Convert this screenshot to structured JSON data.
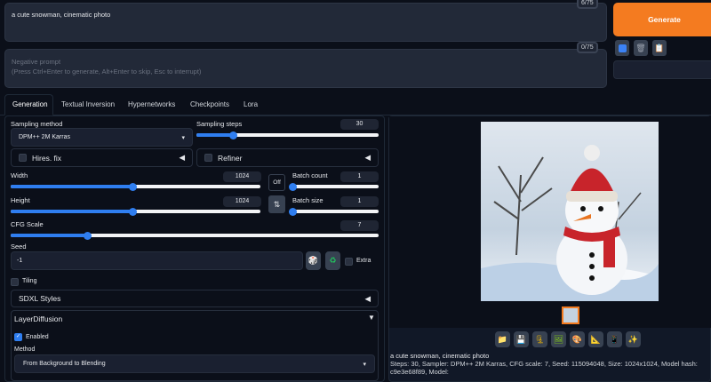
{
  "prompt": {
    "value": "a cute snowman, cinematic photo",
    "counter": "6/75"
  },
  "negative_prompt": {
    "placeholder_line1": "Negative prompt",
    "placeholder_line2": "(Press Ctrl+Enter to generate, Alt+Enter to skip, Esc to interrupt)",
    "counter": "0/75"
  },
  "generate_label": "Generate",
  "tabs": [
    "Generation",
    "Textual Inversion",
    "Hypernetworks",
    "Checkpoints",
    "Lora"
  ],
  "sampling_method": {
    "label": "Sampling method",
    "value": "DPM++ 2M Karras"
  },
  "sampling_steps": {
    "label": "Sampling steps",
    "value": "30",
    "fraction": 0.2
  },
  "hires_fix": "Hires. fix",
  "refiner": "Refiner",
  "width": {
    "label": "Width",
    "value": "1024",
    "fraction": 0.49
  },
  "height": {
    "label": "Height",
    "value": "1024",
    "fraction": 0.49
  },
  "batch_count": {
    "label": "Batch count",
    "value": "1",
    "fraction": 0.0
  },
  "batch_size": {
    "label": "Batch size",
    "value": "1",
    "fraction": 0.0
  },
  "off_label": "Off",
  "swap_icon": "⇅",
  "cfg_scale": {
    "label": "CFG Scale",
    "value": "7",
    "fraction": 0.21
  },
  "seed": {
    "label": "Seed",
    "value": "-1",
    "extra": "Extra"
  },
  "tiling": "Tiling",
  "sdxl_styles": "SDXL Styles",
  "layer_diffusion": {
    "title": "LayerDiffusion",
    "enabled": "Enabled",
    "method_label": "Method",
    "method_value": "From Background to Blending"
  },
  "output": {
    "caption": "a cute snowman, cinematic photo",
    "info": "Steps: 30, Sampler: DPM++ 2M Karras, CFG scale: 7, Seed: 115094048, Size: 1024x1024, Model hash: c9e3e68f89, Model:"
  },
  "toolbar_icons": [
    "folder-icon",
    "save-icon",
    "zip-icon",
    "image-icon",
    "palette-icon",
    "ruler-icon",
    "extras-icon",
    "sparkle-icon"
  ],
  "colors": {
    "accent": "#2f7ef0",
    "generate": "#f47b20",
    "background": "#0b0f19"
  }
}
